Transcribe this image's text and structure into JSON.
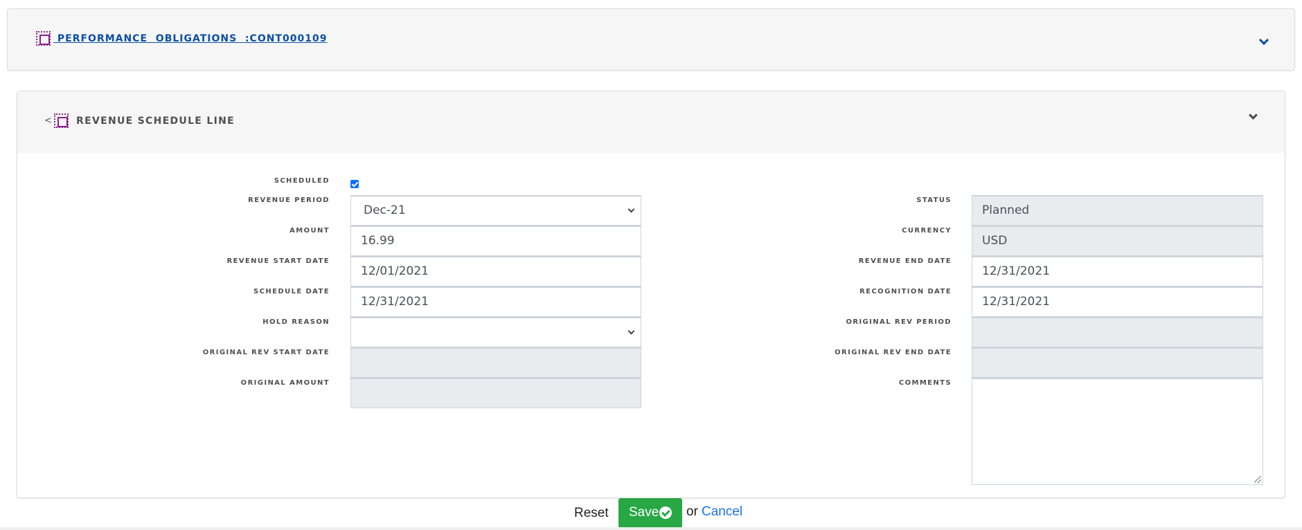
{
  "top_panel": {
    "title": " PERFORMANCE  OBLIGATIONS  :CONT000109",
    "icon": "selection-box-icon",
    "toggle_icon": "chevron-down-icon"
  },
  "main_panel": {
    "back_label": "<",
    "title": "REVENUE  SCHEDULE  LINE",
    "icon": "selection-box-icon",
    "toggle_icon": "chevron-down-icon"
  },
  "form": {
    "left": {
      "scheduled": {
        "label": "SCHEDULED",
        "checked": true
      },
      "revenue_period": {
        "label": "REVENUE  PERIOD",
        "value": "Dec-21"
      },
      "amount": {
        "label": "AMOUNT",
        "value": "16.99"
      },
      "revenue_start_date": {
        "label": "REVENUE  START  DATE",
        "value": "12/01/2021"
      },
      "schedule_date": {
        "label": "SCHEDULE  DATE",
        "value": "12/31/2021"
      },
      "hold_reason": {
        "label": "HOLD  REASON",
        "value": ""
      },
      "original_rev_start_date": {
        "label": "ORIGINAL  REV  START  DATE",
        "value": ""
      },
      "original_amount": {
        "label": "ORIGINAL  AMOUNT",
        "value": ""
      }
    },
    "right": {
      "status": {
        "label": "STATUS",
        "value": "Planned"
      },
      "currency": {
        "label": "CURRENCY",
        "value": "USD"
      },
      "revenue_end_date": {
        "label": "REVENUE  END  DATE",
        "value": "12/31/2021"
      },
      "recognition_date": {
        "label": "RECOGNITION  DATE",
        "value": "12/31/2021"
      },
      "original_rev_period": {
        "label": "ORIGINAL  REV  PERIOD",
        "value": ""
      },
      "original_rev_end_date": {
        "label": "ORIGINAL  REV  END  DATE",
        "value": ""
      },
      "comments": {
        "label": "COMMENTS",
        "value": ""
      }
    }
  },
  "actions": {
    "reset": "Reset",
    "save": "Save",
    "or": "or",
    "cancel": "Cancel"
  },
  "colors": {
    "link_blue": "#0a4fa6",
    "icon_purple": "#8a1f8a",
    "save_green": "#28a745",
    "cancel_blue": "#1a73e8",
    "disabled_bg": "#e9ecef",
    "checkbox_blue": "#0d6efd"
  }
}
